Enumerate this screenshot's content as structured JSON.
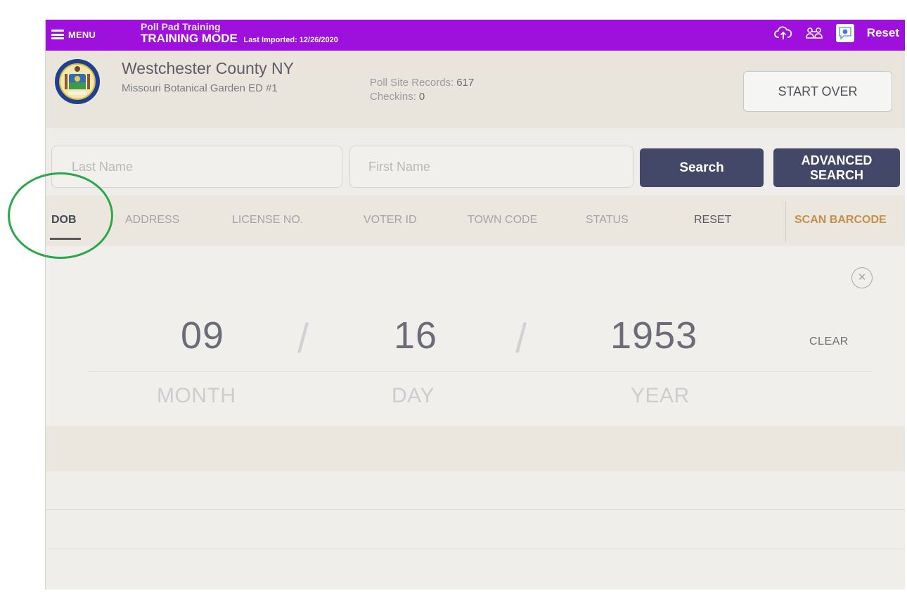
{
  "topbar": {
    "menu_label": "MENU",
    "app_title": "Poll Pad Training",
    "mode": "TRAINING MODE",
    "last_imported": "Last Imported: 12/26/2020",
    "reset_label": "Reset",
    "icons": [
      "menu-icon",
      "cloud-upload-icon",
      "users-icon",
      "chat-icon"
    ],
    "color": "#9e10dc"
  },
  "header": {
    "county": "Westchester County NY",
    "site": "Missouri Botanical Garden ED #1",
    "records_label": "Poll Site Records:",
    "records_value": "617",
    "checkins_label": "Checkins:",
    "checkins_value": "0",
    "start_over": "START OVER"
  },
  "search": {
    "last_name_placeholder": "Last Name",
    "first_name_placeholder": "First Name",
    "search_button": "Search",
    "advanced_line1": "ADVANCED",
    "advanced_line2": "SEARCH"
  },
  "tabs": {
    "dob": "DOB",
    "address": "ADDRESS",
    "license": "LICENSE NO.",
    "voter_id": "VOTER ID",
    "town_code": "TOWN CODE",
    "status": "STATUS",
    "reset": "RESET",
    "scan_barcode": "SCAN BARCODE",
    "active": "DOB"
  },
  "dob": {
    "month": "09",
    "day": "16",
    "year": "1953",
    "separator": "/",
    "month_label": "MONTH",
    "day_label": "DAY",
    "year_label": "YEAR",
    "clear": "CLEAR",
    "close_symbol": "×"
  },
  "colors": {
    "accent_dark": "#434868",
    "barcode": "#c4904a",
    "annotation": "#2aa84a"
  }
}
